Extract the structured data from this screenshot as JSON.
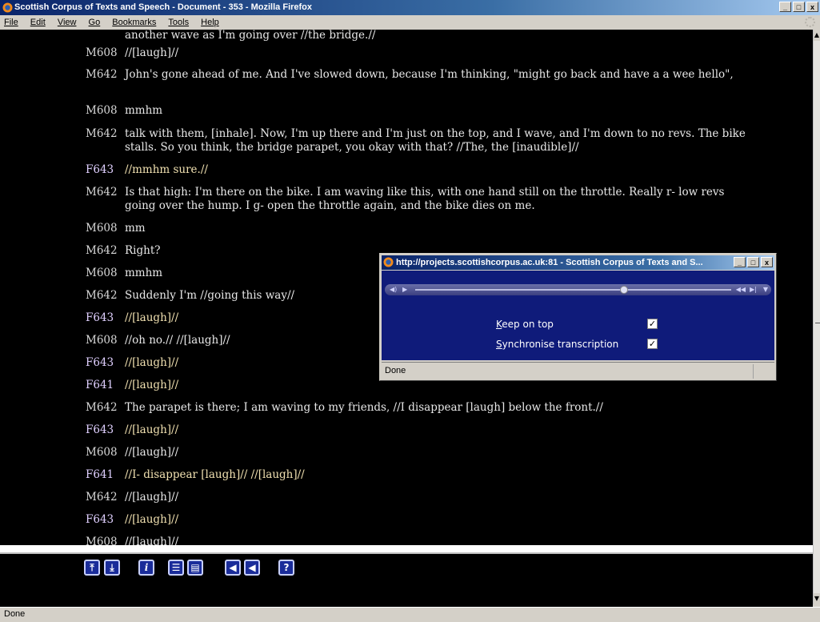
{
  "window": {
    "title": "Scottish Corpus of Texts and Speech - Document - 353 - Mozilla Firefox",
    "minimize": "_",
    "maximize": "□",
    "close": "x"
  },
  "menu": [
    "File",
    "Edit",
    "View",
    "Go",
    "Bookmarks",
    "Tools",
    "Help"
  ],
  "transcript": [
    {
      "speaker": "",
      "text": "another wave as I'm going over //the bridge.//",
      "gender": "m"
    },
    {
      "speaker": "M608",
      "text": "//[laugh]//",
      "gender": "m"
    },
    {
      "speaker": "M642",
      "text": "John's gone ahead of me. And I've slowed down, because I'm thinking, \"might go back and have a a wee hello\",",
      "gender": "m"
    },
    {
      "speaker": "M608",
      "text": "mmhm",
      "gender": "m"
    },
    {
      "speaker": "M642",
      "text": "talk with them, [inhale]. Now, I'm up there and I'm just on the top, and I wave, and I'm down to no revs. The bike stalls. So you think, the bridge parapet, you okay with that? //The, the [inaudible]//",
      "gender": "m"
    },
    {
      "speaker": "F643",
      "text": "//mmhm sure.//",
      "gender": "f"
    },
    {
      "speaker": "M642",
      "text": "Is that high: I'm there on the bike. I am waving like this, with one hand still on the throttle. Really r- low revs going over the hump. I g- open the throttle again, and the bike dies on me.",
      "gender": "m"
    },
    {
      "speaker": "M608",
      "text": "mm",
      "gender": "m"
    },
    {
      "speaker": "M642",
      "text": "Right?",
      "gender": "m"
    },
    {
      "speaker": "M608",
      "text": "mmhm",
      "gender": "m"
    },
    {
      "speaker": "M642",
      "text": "Suddenly I'm //going this way//",
      "gender": "m"
    },
    {
      "speaker": "F643",
      "text": "//[laugh]//",
      "gender": "f"
    },
    {
      "speaker": "M608",
      "text": "//oh no.// //[laugh]//",
      "gender": "m"
    },
    {
      "speaker": "F643",
      "text": "//[laugh]//",
      "gender": "f"
    },
    {
      "speaker": "F641",
      "text": "//[laugh]//",
      "gender": "f"
    },
    {
      "speaker": "M642",
      "text": "The parapet is there; I am waving to my friends, //I disappear [laugh] below the front.//",
      "gender": "m"
    },
    {
      "speaker": "F643",
      "text": "//[laugh]//",
      "gender": "f"
    },
    {
      "speaker": "M608",
      "text": "//[laugh]//",
      "gender": "m"
    },
    {
      "speaker": "F641",
      "text": "//I- disappear [laugh]// //[laugh]//",
      "gender": "f"
    },
    {
      "speaker": "M642",
      "text": "//[laugh]//",
      "gender": "m"
    },
    {
      "speaker": "F643",
      "text": "//[laugh]//",
      "gender": "f"
    },
    {
      "speaker": "M608",
      "text": "//[laugh]//",
      "gender": "m"
    }
  ],
  "toolbar": [
    {
      "name": "go-to-top-button",
      "glyph": "⤒"
    },
    {
      "name": "go-to-bottom-button",
      "glyph": "⤓"
    },
    {
      "name": "info-button",
      "glyph": "i"
    },
    {
      "name": "text-view-button",
      "glyph": "☰"
    },
    {
      "name": "text-audio-view-button",
      "glyph": "▤"
    },
    {
      "name": "audio-button",
      "glyph": "◀"
    },
    {
      "name": "audio-player-button",
      "glyph": "◀"
    },
    {
      "name": "help-button",
      "glyph": "?"
    }
  ],
  "popup": {
    "title": "http://projects.scottishcorpus.ac.uk:81 - Scottish Corpus of Texts and S...",
    "keep_on_top": {
      "accesskey": "K",
      "rest": "eep on top",
      "checked": true
    },
    "sync": {
      "accesskey": "S",
      "rest": "ynchronise transcription",
      "checked": true
    },
    "status": "Done",
    "progress": 0.66
  },
  "status": "Done"
}
